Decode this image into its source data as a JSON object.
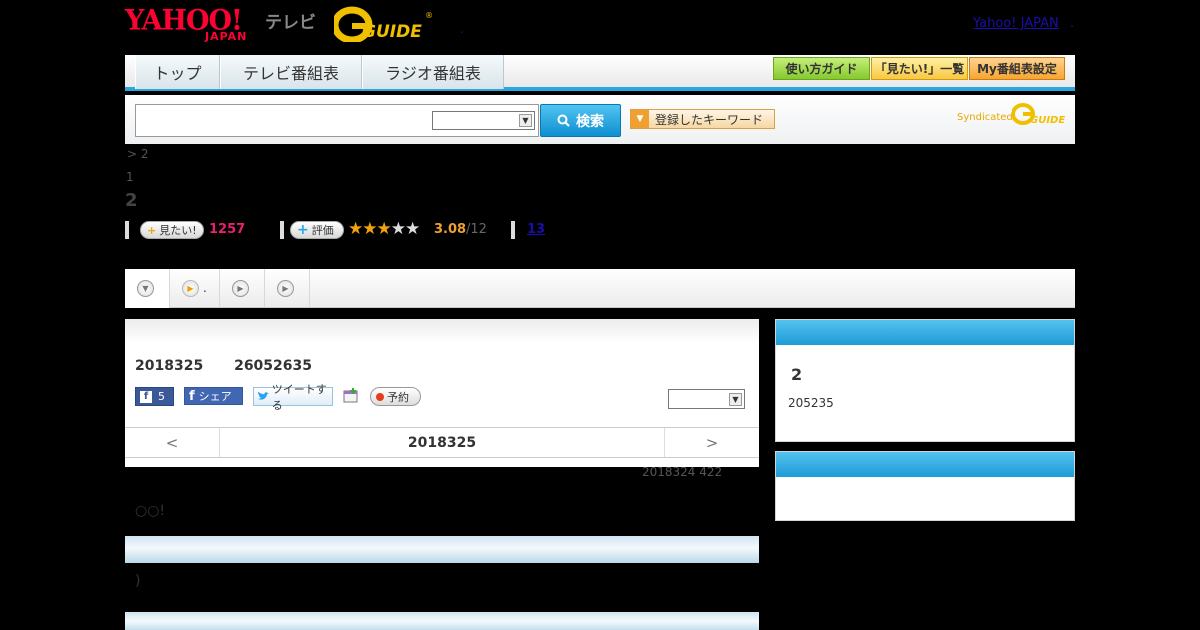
{
  "header": {
    "yahoo_logo": "YAHOO!",
    "yahoo_sub": "JAPAN",
    "tv_label": "テレビ",
    "gguide_logo": "G GUIDE",
    "yahoo_japan_link": "Yahoo! JAPAN",
    "link_dot": ".",
    "small_dot": "."
  },
  "nav": {
    "tabs": [
      {
        "label": "トップ"
      },
      {
        "label": "テレビ番組表"
      },
      {
        "label": "ラジオ番組表"
      }
    ],
    "buttons": [
      {
        "label": "使い方ガイド",
        "color": "#8fd13a"
      },
      {
        "label": "「見たい!」一覧",
        "color": "#f7c842"
      },
      {
        "label": "My番組表設定",
        "color": "#f7a531"
      }
    ]
  },
  "search": {
    "input_value": "",
    "select_value": "",
    "button_label": "検索",
    "keyword_button_label": "登録したキーワード",
    "syndicated_label": "Syndicated"
  },
  "breadcrumb": "> 2",
  "subtitle": "1",
  "title": "2",
  "stats": {
    "mitai_label": "見たい!",
    "mitai_count": "1257",
    "rate_label": "評価",
    "rating_stars": 3,
    "rating_max": 5,
    "rating_value": "3.08",
    "rating_count": "/12",
    "link_count": "13"
  },
  "tabs": [
    {
      "label": ""
    },
    {
      "label": "."
    },
    {
      "label": ""
    },
    {
      "label": ""
    }
  ],
  "program": {
    "date": "2018325",
    "time": "26052635",
    "fb_count": "5",
    "share_label": "シェア",
    "tweet_label": "ツイートする",
    "reserve_label": "予約",
    "select_value": "",
    "prev_label": "<",
    "current_date": "2018325",
    "next_label": ">"
  },
  "updated": "2018324  422",
  "body_text": "○○!",
  "paren_text": ")",
  "right_panel": {
    "number": "2",
    "sub": "205235"
  },
  "colors": {
    "accent_blue": "#29a7e1",
    "yahoo_red": "#ff0033",
    "gguide_yellow": "#f0c000",
    "pink": "#e6216d",
    "star": "#f2a20c"
  }
}
